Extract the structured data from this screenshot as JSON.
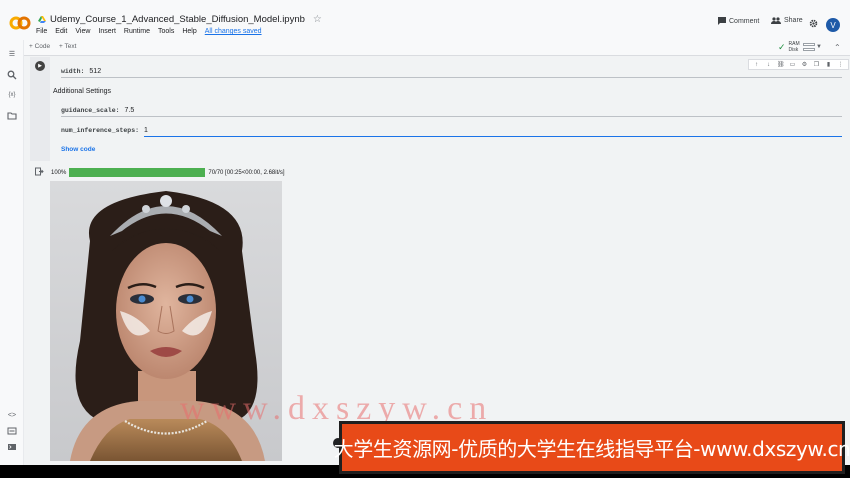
{
  "header": {
    "title": "Udemy_Course_1_Advanced_Stable_Diffusion_Model.ipynb",
    "menu": [
      "File",
      "Edit",
      "View",
      "Insert",
      "Runtime",
      "Tools",
      "Help"
    ],
    "saved_status": "All changes saved",
    "comment_label": "Comment",
    "share_label": "Share",
    "avatar_letter": "V"
  },
  "toolbar": {
    "add_code": "+ Code",
    "add_text": "+ Text",
    "ram_label": "RAM",
    "disk_label": "Disk"
  },
  "cell": {
    "width_label": "width:",
    "width_value": "512",
    "section_title": "Additional Settings",
    "guidance_label": "guidance_scale:",
    "guidance_value": "7.5",
    "steps_label": "num_inference_steps:",
    "steps_value": "1",
    "show_code": "Show code"
  },
  "output": {
    "progress_percent_label": "100%",
    "progress_fraction": 1.0,
    "progress_stats": "70/70 [00:25<00:00, 2.68it/s]"
  },
  "watermark": {
    "url_text": "www.dxszyw.cn",
    "banner_text": "大学生资源网-优质的大学生在线指导平台-www.dxszyw.cn"
  },
  "colors": {
    "accent": "#1a73e8",
    "progress": "#4caf50",
    "banner": "#e84a18",
    "colab_orange": "#f9ab00"
  }
}
